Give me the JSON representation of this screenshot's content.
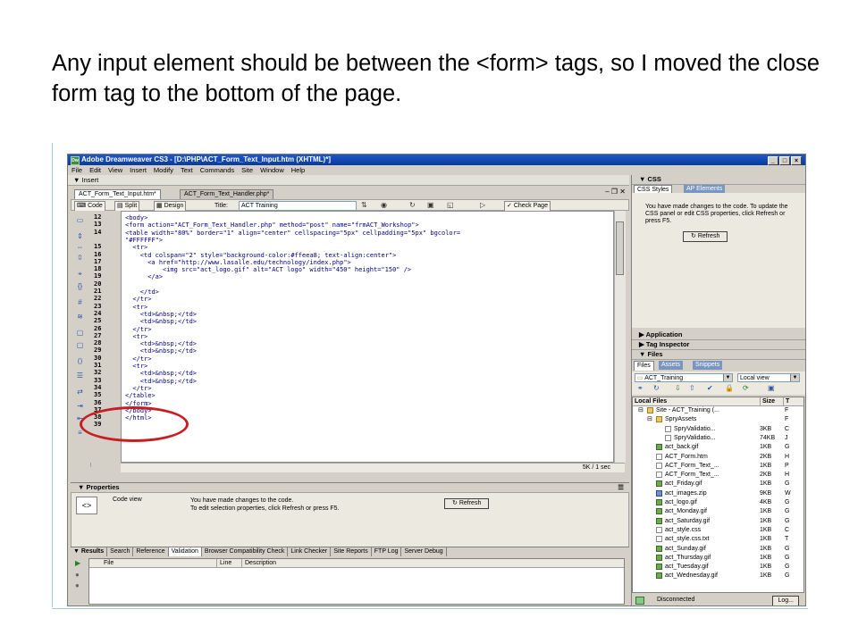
{
  "caption": "Any input element should be between the <form> tags, so I moved the close form tag to the bottom of the page.",
  "app": {
    "title": "Adobe Dreamweaver CS3 - [D:\\PHP\\ACT_Form_Text_Input.htm (XHTML)*]",
    "window_buttons": [
      "_",
      "□",
      "×"
    ]
  },
  "menu": [
    "File",
    "Edit",
    "View",
    "Insert",
    "Modify",
    "Text",
    "Commands",
    "Site",
    "Window",
    "Help"
  ],
  "insert_bar": "▼ Insert",
  "doc_tabs": [
    "ACT_Form_Text_Input.htm*",
    "ACT_Form_Text_Handler.php*"
  ],
  "doc_toolbar": {
    "code": "Code",
    "split": "Split",
    "design": "Design",
    "title_label": "Title:",
    "title_value": "ACT Training",
    "check_page": "Check Page"
  },
  "code_lines": [
    {
      "n": "12",
      "indent": 0,
      "text": "<body>"
    },
    {
      "n": "13",
      "indent": 0,
      "text": "<form action=\"ACT_Form_Text_Handler.php\" method=\"post\" name=\"frmACT_Workshop\">"
    },
    {
      "n": "14",
      "indent": 0,
      "text": "<table width=\"80%\" border=\"1\" align=\"center\" cellspacing=\"5px\" cellpadding=\"5px\" bgcolor="
    },
    {
      "n": "",
      "indent": 0,
      "text": "\"#FFFFFF\">"
    },
    {
      "n": "15",
      "indent": 2,
      "text": "<tr>"
    },
    {
      "n": "16",
      "indent": 4,
      "text": "<td colspan=\"2\" style=\"background-color:#ffeea8; text-align:center\">"
    },
    {
      "n": "17",
      "indent": 6,
      "text": "<a href=\"http://www.lasalle.edu/technology/index.php\">"
    },
    {
      "n": "18",
      "indent": 10,
      "text": "<img src=\"act_logo.gif\" alt=\"ACT logo\" width=\"450\" height=\"150\" />"
    },
    {
      "n": "19",
      "indent": 6,
      "text": "</a>"
    },
    {
      "n": "20",
      "indent": 0,
      "text": ""
    },
    {
      "n": "21",
      "indent": 4,
      "text": "</td>"
    },
    {
      "n": "22",
      "indent": 2,
      "text": "</tr>"
    },
    {
      "n": "23",
      "indent": 2,
      "text": "<tr>"
    },
    {
      "n": "24",
      "indent": 4,
      "text": "<td>&nbsp;</td>"
    },
    {
      "n": "25",
      "indent": 4,
      "text": "<td>&nbsp;</td>"
    },
    {
      "n": "26",
      "indent": 2,
      "text": "</tr>"
    },
    {
      "n": "27",
      "indent": 2,
      "text": "<tr>"
    },
    {
      "n": "28",
      "indent": 4,
      "text": "<td>&nbsp;</td>"
    },
    {
      "n": "29",
      "indent": 4,
      "text": "<td>&nbsp;</td>"
    },
    {
      "n": "30",
      "indent": 2,
      "text": "</tr>"
    },
    {
      "n": "31",
      "indent": 2,
      "text": "<tr>"
    },
    {
      "n": "32",
      "indent": 4,
      "text": "<td>&nbsp;</td>"
    },
    {
      "n": "33",
      "indent": 4,
      "text": "<td>&nbsp;</td>"
    },
    {
      "n": "34",
      "indent": 2,
      "text": "</tr>"
    },
    {
      "n": "35",
      "indent": 0,
      "text": "</table>"
    },
    {
      "n": "36",
      "indent": 0,
      "text": "</form>"
    },
    {
      "n": "37",
      "indent": 0,
      "text": "</body>"
    },
    {
      "n": "38",
      "indent": 0,
      "text": "</html>"
    },
    {
      "n": "39",
      "indent": 0,
      "text": ""
    }
  ],
  "status_bar": "5K / 1 sec",
  "properties": {
    "header": "▼ Properties",
    "label": "Code view",
    "message_line1": "You have made changes to the code.",
    "message_line2": "To edit selection properties, click Refresh or press F5.",
    "refresh": "Refresh"
  },
  "results": {
    "header": "▼ Results",
    "tabs": [
      "Search",
      "Reference",
      "Validation",
      "Browser Compatibility Check",
      "Link Checker",
      "Site Reports",
      "FTP Log",
      "Server Debug"
    ],
    "columns": [
      "File",
      "Line",
      "Description"
    ]
  },
  "css_panel": {
    "header": "▼ CSS",
    "tabs": [
      "CSS Styles",
      "AP Elements"
    ],
    "message": "You have made changes to the code. To update the CSS panel or edit CSS properties, click Refresh or press F5.",
    "refresh": "Refresh"
  },
  "collapsed_panels": [
    "▶ Application",
    "▶ Tag Inspector"
  ],
  "files_panel": {
    "header": "▼ Files",
    "tabs": [
      "Files",
      "Assets",
      "Snippets"
    ],
    "site_select": "ACT_Training",
    "view_select": "Local view",
    "columns": [
      "Local Files",
      "Size",
      "T"
    ],
    "rows": [
      {
        "name": "Site - ACT_Training (...",
        "size": "",
        "type": "F",
        "icon": "folder",
        "level": 0
      },
      {
        "name": "SpryAssets",
        "size": "",
        "type": "F",
        "icon": "folder",
        "level": 1
      },
      {
        "name": "SpryValidatio...",
        "size": "3KB",
        "type": "C",
        "icon": "php",
        "level": 2
      },
      {
        "name": "SpryValidatio...",
        "size": "74KB",
        "type": "J",
        "icon": "php",
        "level": 2
      },
      {
        "name": "act_back.gif",
        "size": "1KB",
        "type": "G",
        "icon": "img",
        "level": 1
      },
      {
        "name": "ACT_Form.htm",
        "size": "2KB",
        "type": "H",
        "icon": "php",
        "level": 1
      },
      {
        "name": "ACT_Form_Text_...",
        "size": "1KB",
        "type": "P",
        "icon": "php",
        "level": 1
      },
      {
        "name": "ACT_Form_Text_...",
        "size": "2KB",
        "type": "H",
        "icon": "php",
        "level": 1
      },
      {
        "name": "act_Friday.gif",
        "size": "1KB",
        "type": "G",
        "icon": "img",
        "level": 1
      },
      {
        "name": "act_images.zip",
        "size": "9KB",
        "type": "W",
        "icon": "zip",
        "level": 1
      },
      {
        "name": "act_logo.gif",
        "size": "4KB",
        "type": "G",
        "icon": "img",
        "level": 1
      },
      {
        "name": "act_Monday.gif",
        "size": "1KB",
        "type": "G",
        "icon": "img",
        "level": 1
      },
      {
        "name": "act_Saturday.gif",
        "size": "1KB",
        "type": "G",
        "icon": "img",
        "level": 1
      },
      {
        "name": "act_style.css",
        "size": "1KB",
        "type": "C",
        "icon": "php",
        "level": 1
      },
      {
        "name": "act_style.css.txt",
        "size": "1KB",
        "type": "T",
        "icon": "php",
        "level": 1
      },
      {
        "name": "act_Sunday.gif",
        "size": "1KB",
        "type": "G",
        "icon": "img",
        "level": 1
      },
      {
        "name": "act_Thursday.gif",
        "size": "1KB",
        "type": "G",
        "icon": "img",
        "level": 1
      },
      {
        "name": "act_Tuesday.gif",
        "size": "1KB",
        "type": "G",
        "icon": "img",
        "level": 1
      },
      {
        "name": "act_Wednesday.gif",
        "size": "1KB",
        "type": "G",
        "icon": "img",
        "level": 1
      }
    ],
    "status": "Disconnected",
    "log_button": "Log..."
  },
  "colors": {
    "titlebar": "#0a3a9c",
    "annotation_circle": "#c81d25",
    "code_text": "#000080"
  }
}
